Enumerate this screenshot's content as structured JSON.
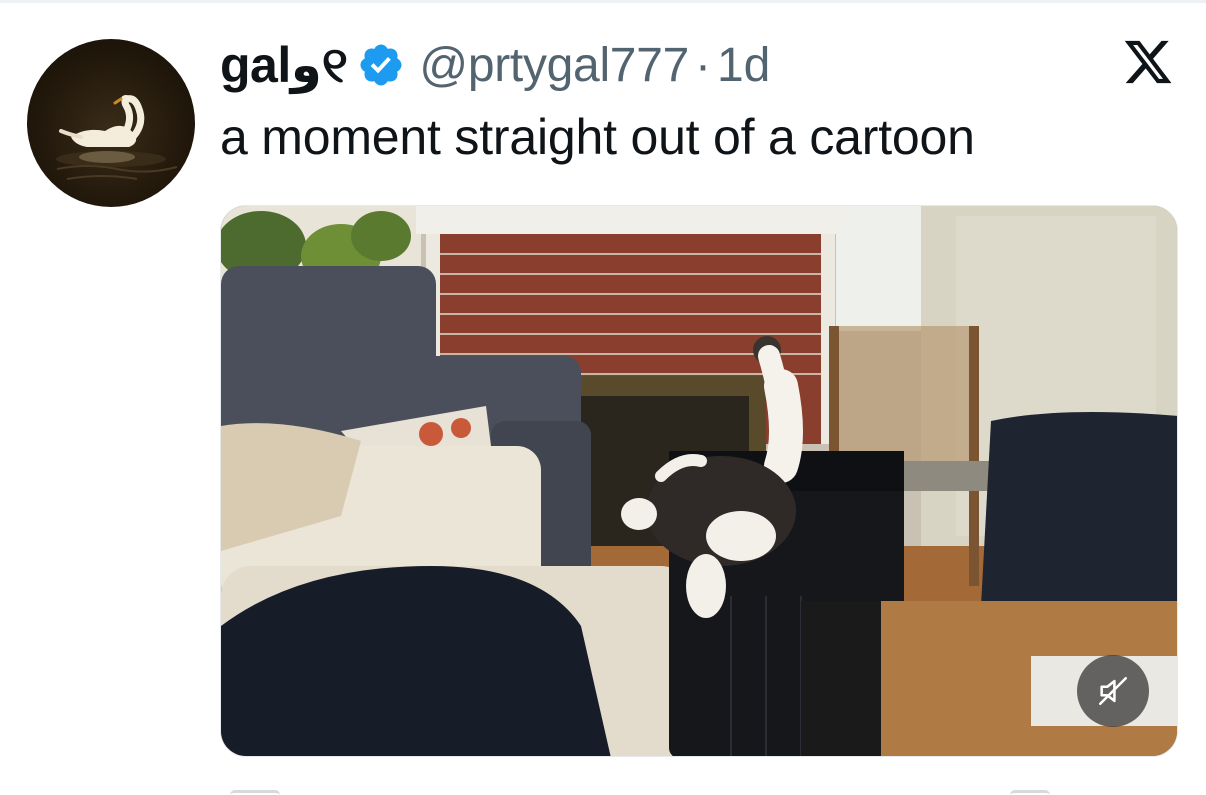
{
  "tweet": {
    "display_name": "galو୧",
    "verified": true,
    "handle": "@prtygal777",
    "separator": "·",
    "time": "1d",
    "text": "a moment straight out of a cartoon"
  },
  "media": {
    "type": "video",
    "muted": true
  },
  "icons": {
    "brand": "x-logo-icon",
    "verified": "verified-badge-icon",
    "mute": "volume-muted-icon"
  },
  "colors": {
    "text": "#0f1419",
    "secondary_text": "#536471",
    "verified_blue": "#1d9bf0",
    "background": "#ffffff"
  }
}
